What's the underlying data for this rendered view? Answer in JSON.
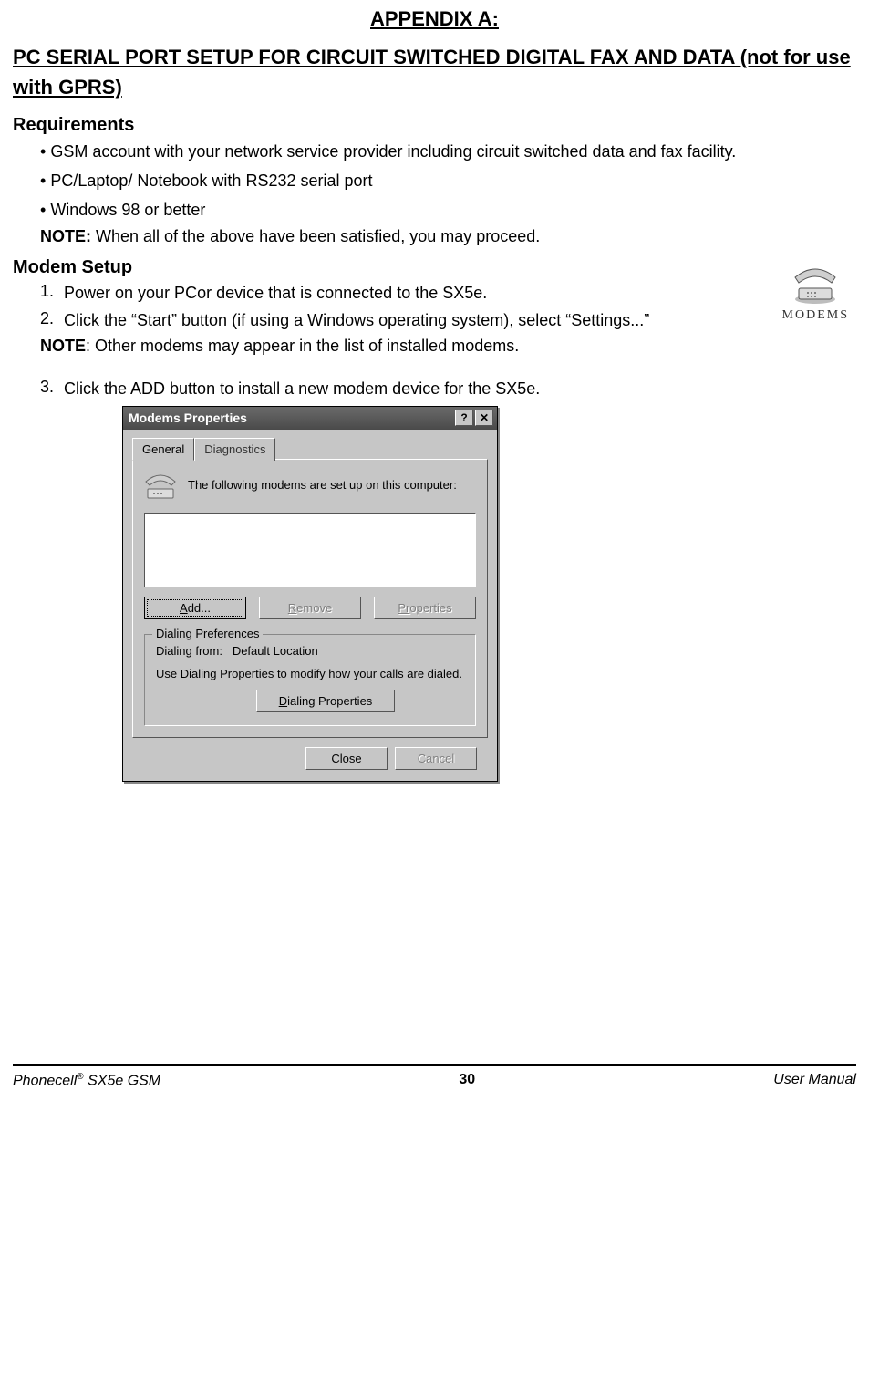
{
  "appendix_title": "APPENDIX A:",
  "section_title": "PC SERIAL PORT SETUP FOR CIRCUIT SWITCHED DIGITAL FAX AND DATA (not for use with GPRS)",
  "requirements_heading": "Requirements",
  "requirements_bullets": [
    "GSM account with your network service provider including circuit switched data and fax facility.",
    "PC/Laptop/ Notebook with RS232 serial port",
    "Windows 98 or better"
  ],
  "req_note_label": "NOTE:",
  "req_note_text": " When all of the above have been satisfied, you may proceed.",
  "modem_heading": "Modem Setup",
  "modem_icon_caption": "MODEMS",
  "steps": {
    "s1_num": "1.",
    "s1_text": "Power on your PCor device that is connected to the SX5e.",
    "s2_num": "2.",
    "s2_text": "Click the “Start” button (if using a Windows operating system), select “Settings...”",
    "note2_label": "NOTE",
    "note2_text": ": Other modems may appear in the list of installed modems.",
    "s3_num": "3.",
    "s3_text": "Click the ADD button to install a new modem device for the SX5e."
  },
  "dialog": {
    "title": "Modems Properties",
    "help_btn": "?",
    "close_btn": "✕",
    "tab_general": "General",
    "tab_diag": "Diagnostics",
    "desc_text": "The following modems are set up on this computer:",
    "btn_add_pre": "A",
    "btn_add_post": "dd...",
    "btn_remove_pre": "R",
    "btn_remove_post": "emove",
    "btn_props_pre": "Pr",
    "btn_props_post": "operties",
    "group_legend": "Dialing Preferences",
    "dial_from_label": "Dialing from:",
    "dial_from_value": "Default Location",
    "dial_help": "Use Dialing Properties to modify how your calls are dialed.",
    "btn_dialprop_pre": "D",
    "btn_dialprop_post": "ialing Properties",
    "btn_close": "Close",
    "btn_cancel": "Cancel"
  },
  "footer": {
    "left_pre": "Phonecell",
    "left_reg": "®",
    "left_post": " SX5e GSM",
    "center": "30",
    "right": "User Manual"
  }
}
